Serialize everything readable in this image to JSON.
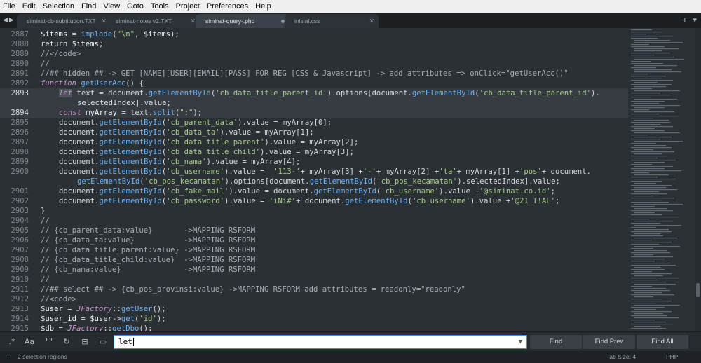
{
  "menu": [
    "File",
    "Edit",
    "Selection",
    "Find",
    "View",
    "Goto",
    "Tools",
    "Project",
    "Preferences",
    "Help"
  ],
  "tabs": [
    {
      "label": "siminat-cb-subtitution.TXT",
      "active": false,
      "dirty": false
    },
    {
      "label": "siminat-notes v2.TXT",
      "active": false,
      "dirty": false
    },
    {
      "label": "siminat-query-.php",
      "active": true,
      "dirty": true
    },
    {
      "label": "inisial.css",
      "active": false,
      "dirty": false
    }
  ],
  "tabbar_icons": {
    "nav": "nav-arrows-icon",
    "add": "+",
    "more": "chevron-down-icon"
  },
  "code_lines": [
    {
      "n": "2887",
      "t": "$items = implode(\"\\n\", $items);"
    },
    {
      "n": "2888",
      "t": "return $items;"
    },
    {
      "n": "2889",
      "t": "//</code>"
    },
    {
      "n": "2890",
      "t": "//"
    },
    {
      "n": "2891",
      "t": "//## hidden ## -> GET [NAME][USER][EMAIL][PASS] FOR REG [CSS & Javascript] -> add attributes => onClick=\"getUserAcc()\""
    },
    {
      "n": "2892",
      "t": "function getUserAcc() {"
    },
    {
      "n": "2893",
      "t": "let text = document.getElementById('cb_data_title_parent_id').options[document.getElementById('cb_data_title_parent_id')."
    },
    {
      "n": "",
      "t": "selectedIndex].value;"
    },
    {
      "n": "2894",
      "t": "const myArray = text.split(\":\");"
    },
    {
      "n": "2895",
      "t": "document.getElementById('cb_parent_data').value = myArray[0];"
    },
    {
      "n": "2896",
      "t": "document.getElementById('cb_data_ta').value = myArray[1];"
    },
    {
      "n": "2897",
      "t": "document.getElementById('cb_data_title_parent').value = myArray[2];"
    },
    {
      "n": "2898",
      "t": "document.getElementById('cb_data_title_child').value = myArray[3];"
    },
    {
      "n": "2899",
      "t": "document.getElementById('cb_nama').value = myArray[4];"
    },
    {
      "n": "2900",
      "t": "document.getElementById('cb_username').value =  '113-'+ myArray[3] +'-'+ myArray[2] +'ta'+ myArray[1] +'pos'+ document."
    },
    {
      "n": "",
      "t": "getElementById('cb_pos_kecamatan').options[document.getElementById('cb_pos_kecamatan').selectedIndex].value;"
    },
    {
      "n": "2901",
      "t": "document.getElementById('cb_fake_mail').value = document.getElementById('cb_username').value +'@siminat.co.id';"
    },
    {
      "n": "2902",
      "t": "document.getElementById('cb_password').value = 'iNi#'+ document.getElementById('cb_username').value +'@21_T!AL';"
    },
    {
      "n": "2903",
      "t": "}"
    },
    {
      "n": "2904",
      "t": "//"
    },
    {
      "n": "2905",
      "t": "// {cb_parent_data:value}       ->MAPPING RSFORM"
    },
    {
      "n": "2906",
      "t": "// {cb_data_ta:value}           ->MAPPING RSFORM"
    },
    {
      "n": "2907",
      "t": "// {cb_data_title_parent:value} ->MAPPING RSFORM"
    },
    {
      "n": "2908",
      "t": "// {cb_data_title_child:value}  ->MAPPING RSFORM"
    },
    {
      "n": "2909",
      "t": "// {cb_nama:value}              ->MAPPING RSFORM"
    },
    {
      "n": "2910",
      "t": "//"
    },
    {
      "n": "2911",
      "t": "//## select ## -> {cb_pos_provinsi:value} ->MAPPING RSFORM add attributes = readonly=\"readonly\""
    },
    {
      "n": "2912",
      "t": "//<code>"
    },
    {
      "n": "2913",
      "t": "$user = JFactory::getUser();"
    },
    {
      "n": "2914",
      "t": "$user_id = $user->get('id');"
    },
    {
      "n": "2915",
      "t": "$db = JFactory::getDbo();"
    }
  ],
  "find": {
    "value": "let",
    "options": [
      ".*",
      "Aa",
      "\"\"",
      "wrap-icon",
      "selection-icon",
      "highlight-icon"
    ],
    "buttons": [
      "Find",
      "Find Prev",
      "Find All"
    ]
  },
  "status": {
    "selection": "2 selection regions",
    "tab_size": "Tab Size: 4",
    "syntax": "PHP"
  },
  "colors": {
    "accent": "#4a90d9",
    "editor_bg": "#2b3035",
    "string": "#a8cc8c",
    "function": "#6ab0f3",
    "keyword": "#c594c5"
  }
}
